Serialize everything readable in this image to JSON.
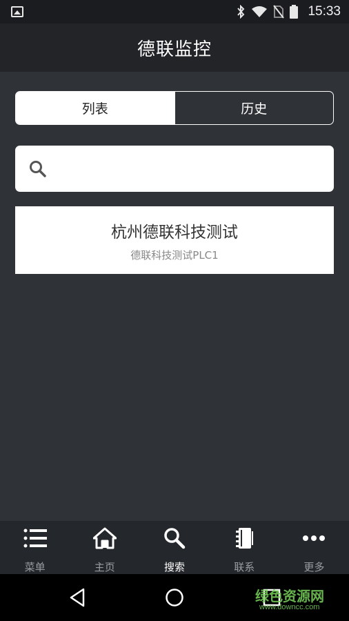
{
  "status_bar": {
    "time": "15:33",
    "icons": [
      "image-icon",
      "bluetooth-icon",
      "wifi-icon",
      "no-sim-icon",
      "battery-icon"
    ]
  },
  "header": {
    "title": "德联监控"
  },
  "tabs": {
    "list_label": "列表",
    "history_label": "历史",
    "selected": "列表"
  },
  "search": {
    "value": "",
    "placeholder": ""
  },
  "devices": [
    {
      "name": "杭州德联科技测试",
      "subtitle": "德联科技测试PLC1"
    }
  ],
  "bottom_nav": {
    "items": [
      {
        "label": "菜单",
        "icon": "menu-list-icon"
      },
      {
        "label": "主页",
        "icon": "home-icon"
      },
      {
        "label": "搜索",
        "icon": "search-icon"
      },
      {
        "label": "联系",
        "icon": "contact-book-icon"
      },
      {
        "label": "更多",
        "icon": "more-dots-icon"
      }
    ],
    "active": "搜索"
  },
  "watermark": {
    "text": "绿色资源网",
    "url": "www.downcc.com"
  },
  "colors": {
    "background": "#2f3237",
    "header": "#222428",
    "nav": "#24272b",
    "active_label": "#ffffff",
    "inactive_label": "#9a9da3"
  }
}
